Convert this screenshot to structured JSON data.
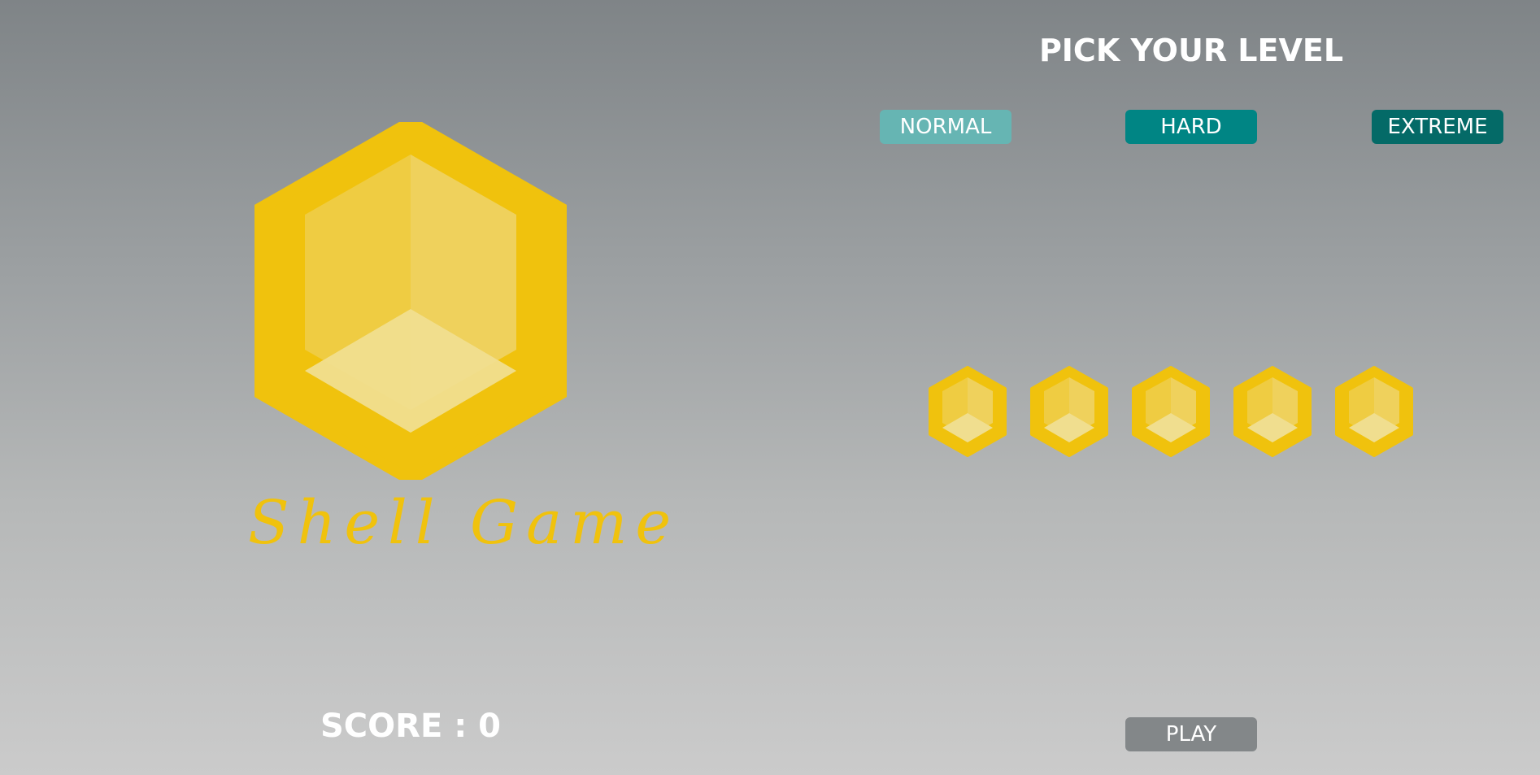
{
  "game": {
    "title": "Shell Game",
    "score_label": "SCORE : 0",
    "score": 0
  },
  "level_picker": {
    "heading": "PICK YOUR LEVEL",
    "levels": [
      {
        "label": "NORMAL",
        "color": "#66b5b3"
      },
      {
        "label": "HARD",
        "color": "#008584"
      },
      {
        "label": "EXTREME",
        "color": "#046a67"
      }
    ]
  },
  "shells": {
    "count": 5,
    "icon": "hexagon-shell-icon"
  },
  "play": {
    "label": "PLAY",
    "color": "#838789"
  },
  "colors": {
    "shell_gold": "#f0c20d",
    "background_top": "#7f8487",
    "background_bottom": "#cbcbcb"
  }
}
